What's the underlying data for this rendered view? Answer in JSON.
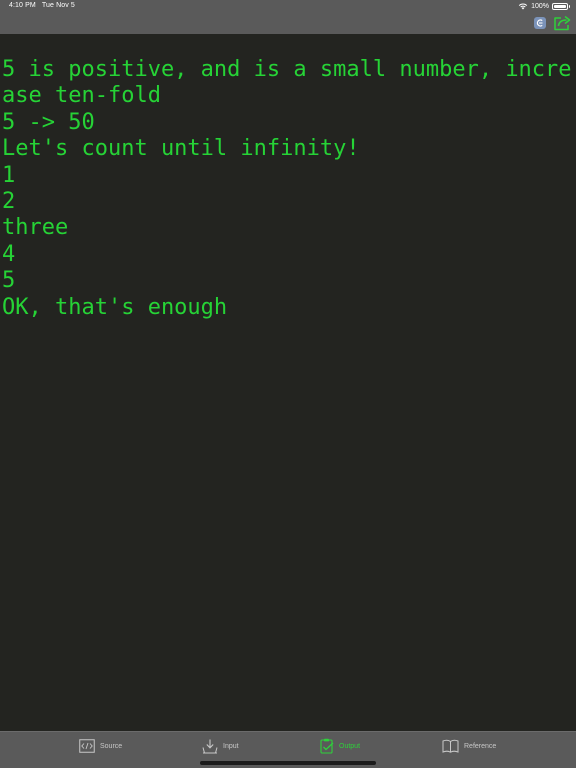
{
  "status_bar": {
    "time": "4:10 PM",
    "date": "Tue Nov 5",
    "battery": "100%",
    "battery_level": 1.0
  },
  "toolbar": {
    "clear_icon": "clear-console-icon",
    "share_icon": "share-icon",
    "accent_color": "#2ed13b"
  },
  "output": {
    "text_color": "#26d336",
    "lines": [
      "5 is positive, and is a small number, incre",
      "ase ten-fold",
      "5 -> 50",
      "Let's count until infinity!",
      "1",
      "2",
      "three",
      "4",
      "5",
      "OK, that's enough"
    ]
  },
  "tabs": [
    {
      "label": "Source",
      "icon": "code-icon",
      "active": false
    },
    {
      "label": "Input",
      "icon": "download-tray-icon",
      "active": false
    },
    {
      "label": "Output",
      "icon": "clipboard-check-icon",
      "active": true
    },
    {
      "label": "Reference",
      "icon": "book-icon",
      "active": false
    }
  ]
}
